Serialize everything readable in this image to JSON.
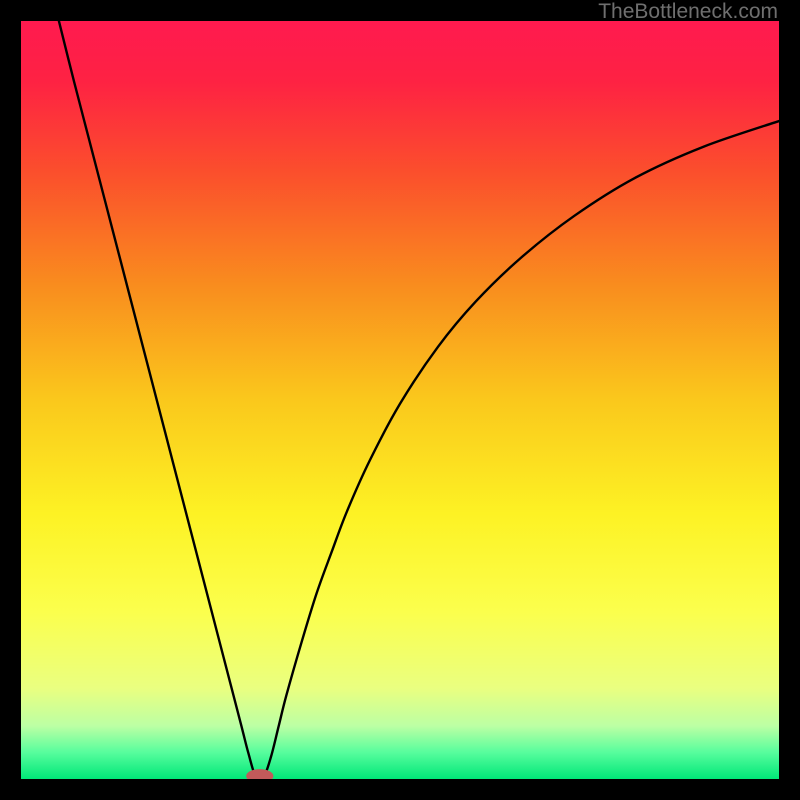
{
  "watermark": "TheBottleneck.com",
  "chart_data": {
    "type": "line",
    "title": "",
    "xlabel": "",
    "ylabel": "",
    "xlim": [
      0,
      100
    ],
    "ylim": [
      0,
      100
    ],
    "grid": false,
    "background_gradient": {
      "stops": [
        {
          "pos": 0.0,
          "color": "#ff1a4f"
        },
        {
          "pos": 0.08,
          "color": "#fe2243"
        },
        {
          "pos": 0.2,
          "color": "#fb4f2c"
        },
        {
          "pos": 0.35,
          "color": "#f98d1e"
        },
        {
          "pos": 0.5,
          "color": "#fac81c"
        },
        {
          "pos": 0.65,
          "color": "#fdf224"
        },
        {
          "pos": 0.78,
          "color": "#fbff4d"
        },
        {
          "pos": 0.88,
          "color": "#eaff80"
        },
        {
          "pos": 0.93,
          "color": "#bcffa4"
        },
        {
          "pos": 0.965,
          "color": "#57fd9d"
        },
        {
          "pos": 1.0,
          "color": "#00e778"
        }
      ]
    },
    "series": [
      {
        "name": "curve",
        "color": "#000000",
        "x": [
          5,
          7,
          9,
          11,
          13,
          15,
          17,
          19,
          21,
          23,
          25,
          27,
          29,
          30,
          31,
          32,
          33,
          34,
          35,
          37,
          39,
          41,
          43,
          46,
          50,
          55,
          60,
          66,
          73,
          81,
          90,
          100
        ],
        "y": [
          100,
          92,
          84.3,
          76.6,
          68.9,
          61.2,
          53.5,
          45.8,
          38.1,
          30.4,
          22.7,
          15,
          7.3,
          3.4,
          0.2,
          0.2,
          3,
          7,
          11,
          18,
          24.5,
          30,
          35.3,
          42,
          49.5,
          57,
          63,
          68.8,
          74.3,
          79.3,
          83.4,
          86.8
        ]
      }
    ],
    "marker": {
      "name": "min-marker",
      "shape": "pill",
      "color": "#c25a5a",
      "cx": 31.5,
      "cy": 0.4,
      "rx": 1.8,
      "ry": 0.9
    }
  }
}
